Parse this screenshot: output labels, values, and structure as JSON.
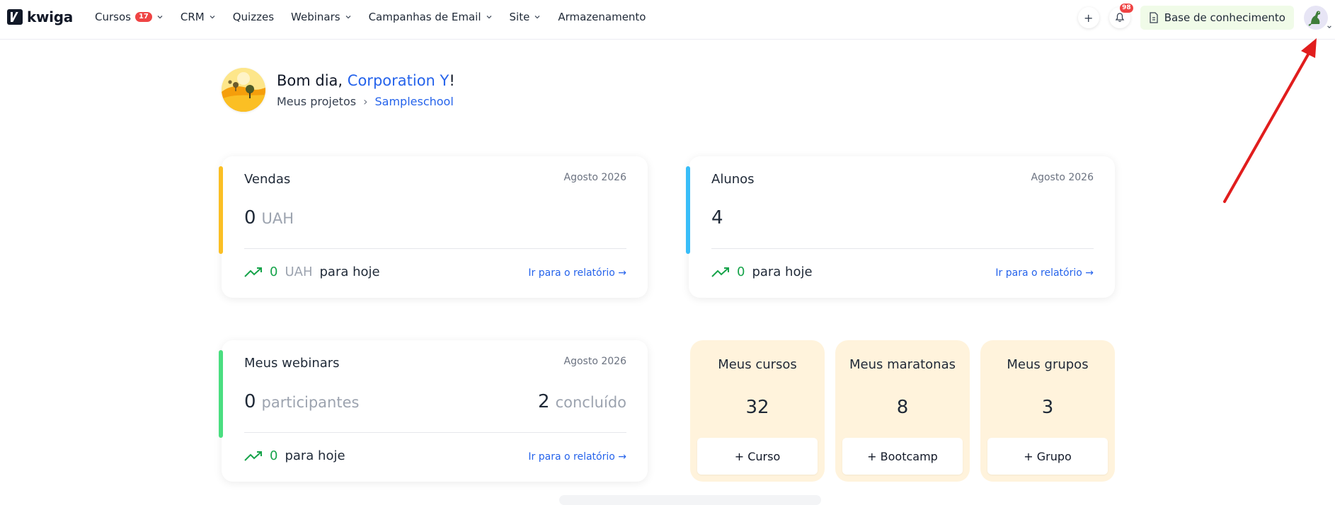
{
  "brand": {
    "name": "kwiga"
  },
  "nav": {
    "items": [
      {
        "label": "Cursos",
        "badge": "17",
        "has_dropdown": true
      },
      {
        "label": "CRM",
        "has_dropdown": true
      },
      {
        "label": "Quizzes",
        "has_dropdown": false
      },
      {
        "label": "Webinars",
        "has_dropdown": true
      },
      {
        "label": "Campanhas de Email",
        "has_dropdown": true
      },
      {
        "label": "Site",
        "has_dropdown": true
      },
      {
        "label": "Armazenamento",
        "has_dropdown": false
      }
    ],
    "add_icon": "plus-icon",
    "notifications_badge": "98",
    "knowledge_base_label": "Base de conhecimento"
  },
  "greeting": {
    "prefix": "Bom dia,",
    "name": "Corporation Y",
    "suffix": "!",
    "breadcrumb_root": "Meus projetos",
    "breadcrumb_current": "Sampleschool"
  },
  "sales": {
    "title": "Vendas",
    "date": "Agosto 2026",
    "value": "0",
    "unit": "UAH",
    "today_value": "0",
    "today_unit": "UAH",
    "today_label": "para hoje",
    "report_link": "Ir para o relatório →",
    "accent": "#fbbf24"
  },
  "students": {
    "title": "Alunos",
    "date": "Agosto 2026",
    "value": "4",
    "today_value": "0",
    "today_label": "para hoje",
    "report_link": "Ir para o relatório →",
    "accent": "#38bdf8"
  },
  "webinars": {
    "title": "Meus webinars",
    "date": "Agosto 2026",
    "participants_value": "0",
    "participants_label": "participantes",
    "completed_value": "2",
    "completed_label": "concluído",
    "today_value": "0",
    "today_label": "para hoje",
    "report_link": "Ir para o relatório →",
    "accent": "#4ade80"
  },
  "summary_cards": [
    {
      "title": "Meus cursos",
      "count": "32",
      "button": "+ Curso"
    },
    {
      "title": "Meus maratonas",
      "count": "8",
      "button": "+ Bootcamp"
    },
    {
      "title": "Meus grupos",
      "count": "3",
      "button": "+ Grupo"
    }
  ],
  "colors": {
    "link": "#2563eb",
    "positive": "#16a34a",
    "annotation": "#e11d1d"
  }
}
